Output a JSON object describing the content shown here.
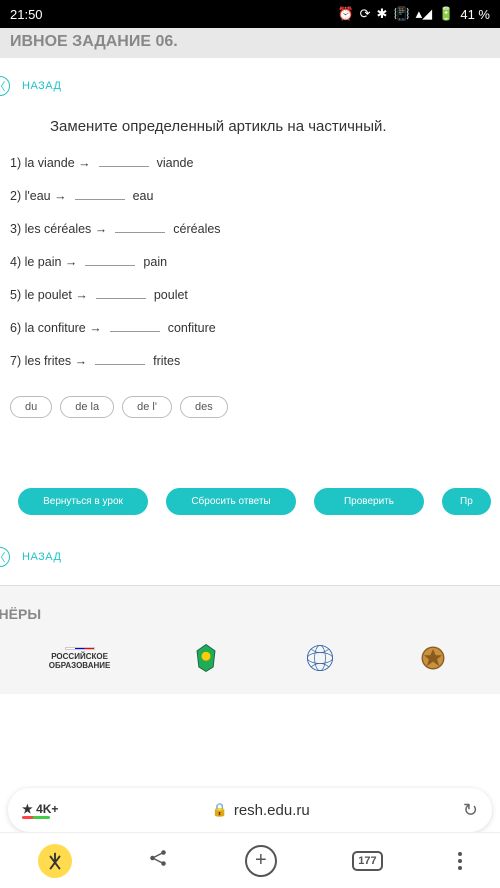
{
  "status": {
    "time": "21:50",
    "battery": "41 %"
  },
  "header_cut": "ИВНОЕ ЗАДАНИЕ 06.",
  "back_label": "НАЗАД",
  "instruction": "Замените определенный артикль на частичный.",
  "exercises": [
    {
      "num": "1)",
      "left": "la viande →",
      "right": "viande"
    },
    {
      "num": "2)",
      "left": "l'eau →",
      "right": "eau"
    },
    {
      "num": "3)",
      "left": "les céréales →",
      "right": "céréales"
    },
    {
      "num": "4)",
      "left": "le pain →",
      "right": "pain"
    },
    {
      "num": "5)",
      "left": "le poulet →",
      "right": "poulet"
    },
    {
      "num": "6)",
      "left": "la confiture →",
      "right": "confiture"
    },
    {
      "num": "7)",
      "left": "les frites →",
      "right": "frites"
    }
  ],
  "chips": [
    "du",
    "de la",
    "de l'",
    "des"
  ],
  "actions": {
    "return": "Вернуться в урок",
    "reset": "Сбросить ответы",
    "check": "Проверить",
    "cut": "Пр"
  },
  "partners": {
    "title": "ТНЁРЫ",
    "logo1_line1": "РОССИЙСКОЕ",
    "logo1_line2": "ОБРАЗОВАНИЕ"
  },
  "browser": {
    "rating": "★ 4K+",
    "url": "resh.edu.ru",
    "tabs": "177"
  }
}
